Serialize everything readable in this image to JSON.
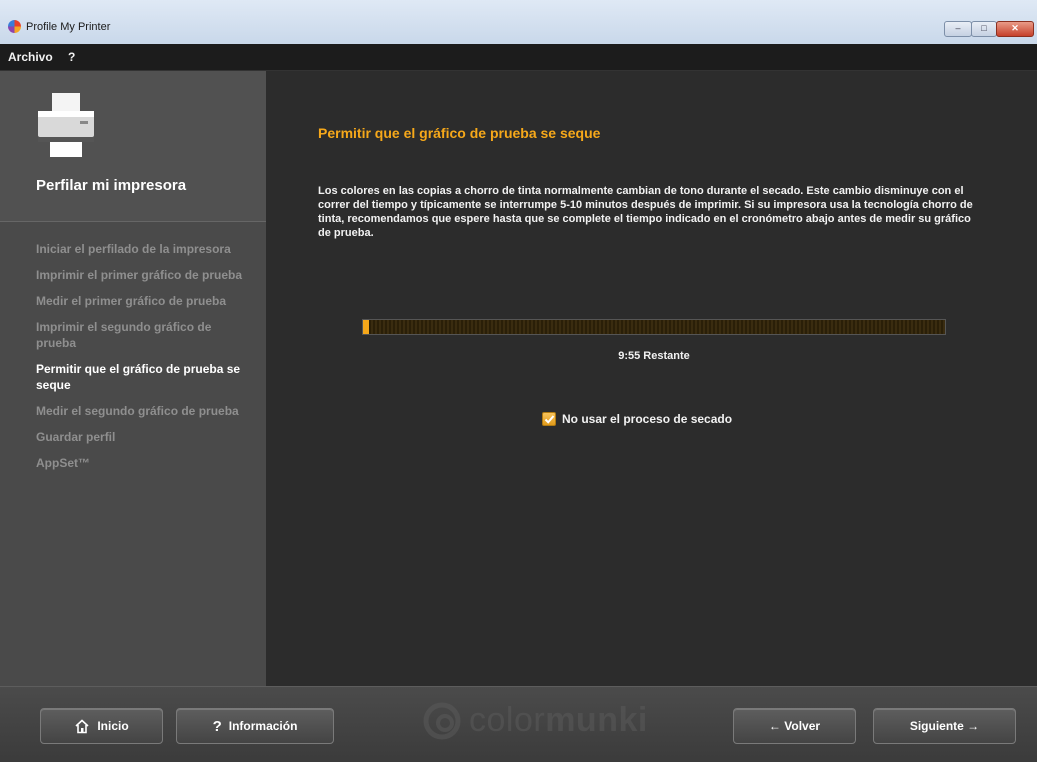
{
  "window": {
    "title": "Profile My Printer",
    "controls": {
      "minimize": "–",
      "maximize": "□",
      "close": "✕"
    }
  },
  "menu": {
    "items": [
      "Archivo",
      "?"
    ]
  },
  "sidebar": {
    "title": "Perfilar mi impresora",
    "steps": [
      {
        "label": "Iniciar el perfilado de la impresora",
        "active": false
      },
      {
        "label": "Imprimir el primer gráfico de prueba",
        "active": false
      },
      {
        "label": "Medir el primer gráfico de prueba",
        "active": false
      },
      {
        "label": "Imprimir el segundo gráfico de prueba",
        "active": false
      },
      {
        "label": "Permitir que el gráfico de prueba se seque",
        "active": true
      },
      {
        "label": "Medir el segundo gráfico de prueba",
        "active": false
      },
      {
        "label": "Guardar perfil",
        "active": false
      },
      {
        "label": "AppSet™",
        "active": false
      }
    ]
  },
  "main": {
    "title": "Permitir que el gráfico de prueba se seque",
    "description": "Los colores en las copias a chorro de tinta normalmente cambian de tono durante el secado. Este cambio disminuye con el correr del tiempo y típicamente se interrumpe 5-10 minutos después de imprimir. Si su impresora usa la tecnología chorro de tinta, recomendamos que espere hasta que se complete el tiempo indicado en el cronómetro abajo antes de medir su gráfico de prueba.",
    "progress": {
      "fraction": 0.01,
      "label": "9:55 Restante"
    },
    "checkbox": {
      "label": "No usar el proceso de secado",
      "checked": true
    }
  },
  "footer": {
    "home_label": "Inicio",
    "info_label": "Información",
    "back_label": "← Volver",
    "next_label": "Siguiente →",
    "brand_light": "color",
    "brand_bold": "munki"
  },
  "colors": {
    "accent": "#f6a81a",
    "sidebar_bg": "#4a4a4a",
    "main_bg": "#2c2c2c"
  }
}
